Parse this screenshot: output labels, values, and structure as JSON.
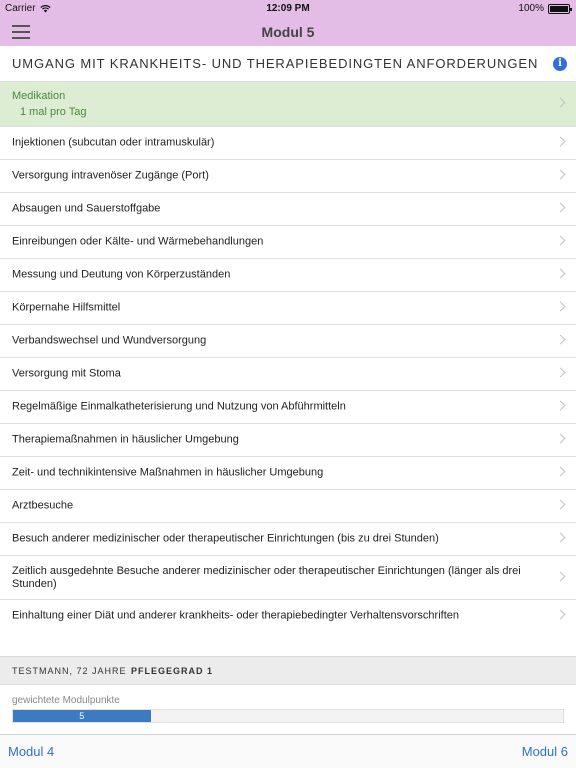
{
  "status_bar": {
    "carrier": "Carrier",
    "time": "12:09 PM",
    "battery": "100%"
  },
  "nav": {
    "title": "Modul 5"
  },
  "section": {
    "title": "UMGANG MIT KRANKHEITS- UND THERAPIEBEDINGTEN ANFORDERUNGEN"
  },
  "list": {
    "selected": {
      "label": "Medikation",
      "value": "1 mal pro Tag"
    },
    "items": [
      "Injektionen (subcutan oder intramuskulär)",
      "Versorgung intravenöser Zugänge (Port)",
      "Absaugen und Sauerstoffgabe",
      "Einreibungen oder Kälte- und Wärmebehandlungen",
      "Messung und Deutung von Körperzuständen",
      "Körpernahe Hilfsmittel",
      "Verbandswechsel und Wundversorgung",
      "Versorgung mit Stoma",
      "Regelmäßige Einmalkatheterisierung und Nutzung von Abführmitteln",
      "Therapiemaßnahmen in häuslicher Umgebung",
      "Zeit- und technikintensive Maßnahmen in häuslicher Umgebung",
      "Arztbesuche",
      "Besuch anderer medizinischer oder therapeutischer Einrichtungen (bis zu drei Stunden)",
      "Zeitlich ausgedehnte Besuche anderer medizinischer oder therapeutischer Einrichtungen (länger als drei Stunden)",
      "Einhaltung einer Diät und anderer krankheits- oder therapiebedingter Verhaltensvorschriften"
    ]
  },
  "footer": {
    "patient": "TESTMANN, 72 JAHRE",
    "grade": "PFLEGEGRAD 1",
    "points_label": "gewichtete Modulpunkte",
    "points_value": "5",
    "points_fraction": 0.25
  },
  "bottom_nav": {
    "prev": "Modul 4",
    "next": "Modul 6"
  },
  "colors": {
    "nav_background": "#e3bde6",
    "selected_row": "#dcedd3",
    "selected_text": "#4b8a3a",
    "accent": "#2f6fd6",
    "progress": "#3c7bc1"
  }
}
